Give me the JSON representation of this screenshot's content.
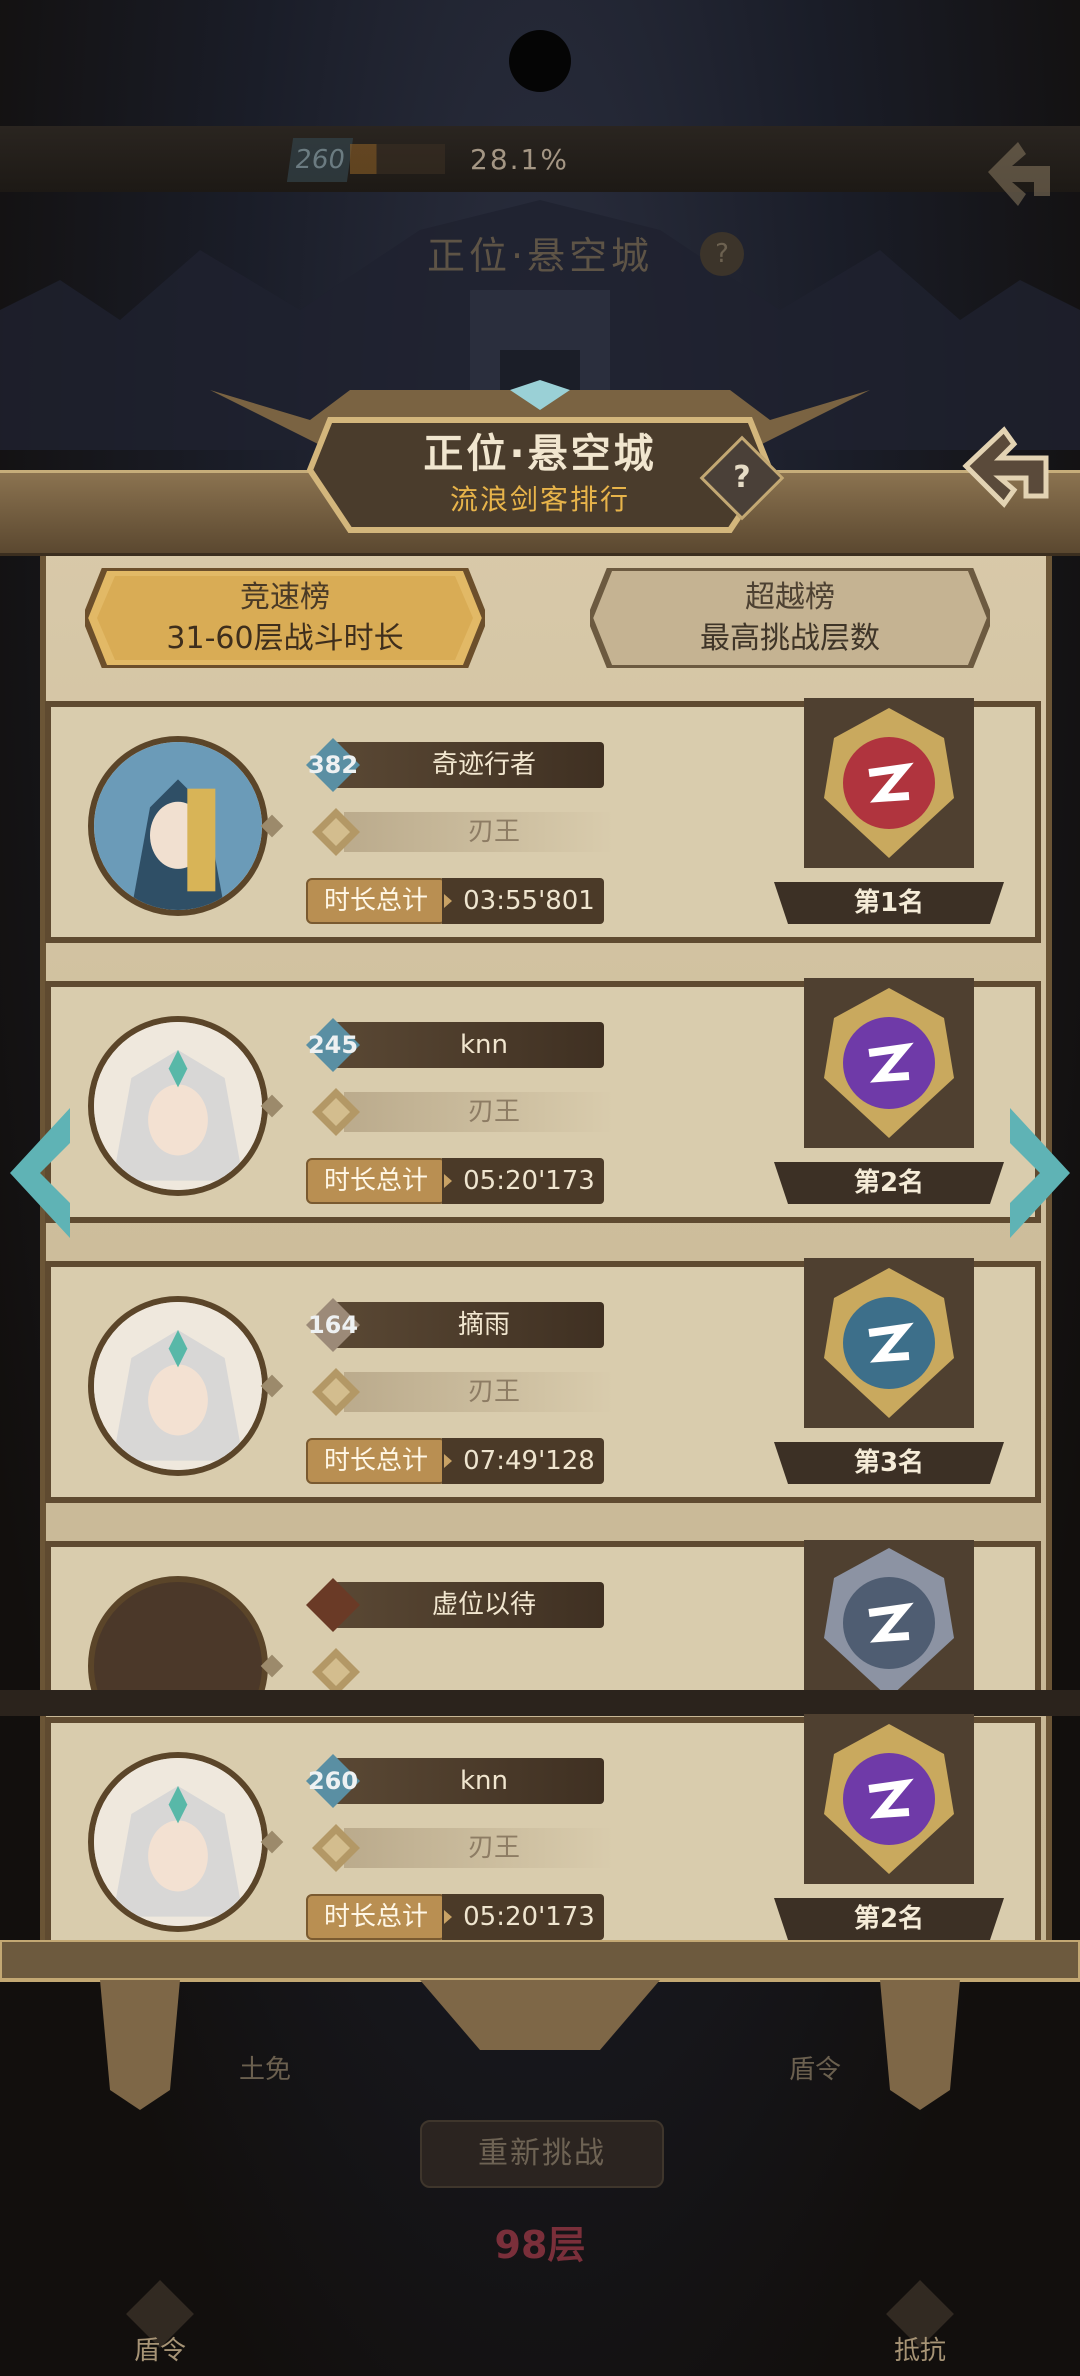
{
  "top_bar": {
    "level": "260",
    "progress_percent": 28.1,
    "progress_text": "28.1%"
  },
  "background": {
    "title": "正位·悬空城",
    "help_label": "?"
  },
  "panel": {
    "title": "正位·悬空城",
    "subtitle": "流浪剑客排行",
    "help_label": "?"
  },
  "tabs": [
    {
      "name": "竞速榜",
      "desc": "31-60层战斗时长",
      "selected": true
    },
    {
      "name": "超越榜",
      "desc": "最高挑战层数",
      "selected": false
    }
  ],
  "ranking": [
    {
      "level": "382",
      "name": "奇迹行者",
      "class": "刃王",
      "time_label": "时长总计",
      "time": "03:55'801",
      "rank": "第1名",
      "emblem_color": "#b0343e"
    },
    {
      "level": "245",
      "name": "knn",
      "class": "刃王",
      "time_label": "时长总计",
      "time": "05:20'173",
      "rank": "第2名",
      "emblem_color": "#6f3aa8"
    },
    {
      "level": "164",
      "name": "摘雨",
      "class": "刃王",
      "time_label": "时长总计",
      "time": "07:49'128",
      "rank": "第3名",
      "emblem_color": "#3d6f8a"
    },
    {
      "level": "",
      "name": "虚位以待",
      "class": "",
      "time_label": "",
      "time": "",
      "rank": "",
      "emblem_color": "#4f5d72"
    }
  ],
  "my_rank": {
    "level": "260",
    "name": "knn",
    "class": "刃王",
    "time_label": "时长总计",
    "time": "05:20'173",
    "rank": "第2名",
    "emblem_color": "#6f3aa8"
  },
  "footer": {
    "left_label": "土免",
    "right_label": "盾令",
    "retry_label": "重新挑战",
    "floor_label": "98层",
    "bottom_left_slot": "盾令",
    "bottom_right_slot": "抵抗"
  },
  "colors": {
    "parchment": "#d2c3a2",
    "frame_gold": "#c6ad7a",
    "frame_dark": "#5b4830",
    "accent_teal": "#5fb3b5"
  }
}
